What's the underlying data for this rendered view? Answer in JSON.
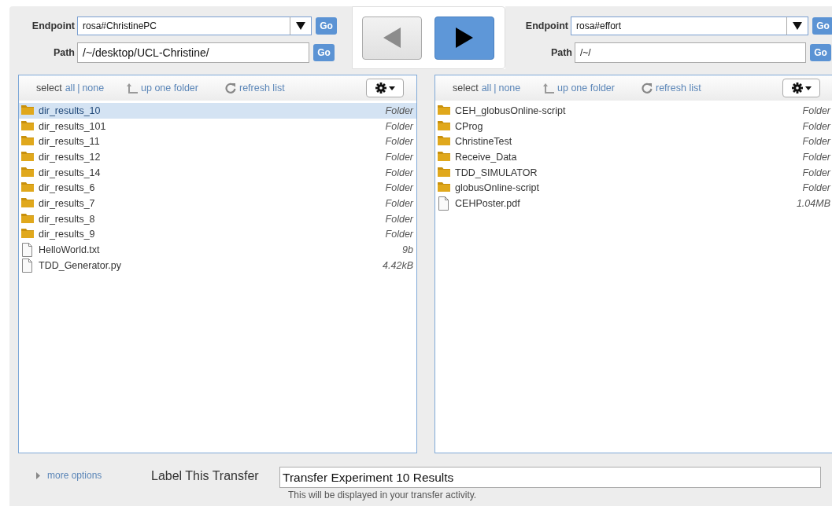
{
  "endpoints": [
    {
      "endpoint_label": "Endpoint",
      "endpoint": "rosa#ChristinePC",
      "endpoint_go": "Go",
      "path_label": "Path",
      "path": "/~/desktop/UCL-Christine/",
      "path_go": "Go"
    },
    {
      "endpoint_label": "Endpoint",
      "endpoint": "rosa#effort",
      "endpoint_go": "Go",
      "path_label": "Path",
      "path": "/~/",
      "path_go": "Go"
    }
  ],
  "transfer_buttons": [
    {
      "kind": "left",
      "active": false
    },
    {
      "kind": "right",
      "active": true
    }
  ],
  "file_lists": [
    {
      "toolbar": {
        "select": "select",
        "all": "all",
        "separator": "|",
        "none": "none",
        "up": "up one folder",
        "refresh": "refresh list"
      },
      "items": [
        {
          "kind": "folder",
          "name": "dir_results_10",
          "size": "Folder",
          "selected": true
        },
        {
          "kind": "folder",
          "name": "dir_results_101",
          "size": "Folder",
          "selected": false
        },
        {
          "kind": "folder",
          "name": "dir_results_11",
          "size": "Folder",
          "selected": false
        },
        {
          "kind": "folder",
          "name": "dir_results_12",
          "size": "Folder",
          "selected": false
        },
        {
          "kind": "folder",
          "name": "dir_results_14",
          "size": "Folder",
          "selected": false
        },
        {
          "kind": "folder",
          "name": "dir_results_6",
          "size": "Folder",
          "selected": false
        },
        {
          "kind": "folder",
          "name": "dir_results_7",
          "size": "Folder",
          "selected": false
        },
        {
          "kind": "folder",
          "name": "dir_results_8",
          "size": "Folder",
          "selected": false
        },
        {
          "kind": "folder",
          "name": "dir_results_9",
          "size": "Folder",
          "selected": false
        },
        {
          "kind": "file",
          "name": "HelloWorld.txt",
          "size": "9b",
          "selected": false
        },
        {
          "kind": "file",
          "name": "TDD_Generator.py",
          "size": "4.42kB",
          "selected": false
        }
      ]
    },
    {
      "toolbar": {
        "select": "select",
        "all": "all",
        "separator": "|",
        "none": "none",
        "up": "up one folder",
        "refresh": "refresh list"
      },
      "items": [
        {
          "kind": "folder",
          "name": "CEH_globusOnline-script",
          "size": "Folder",
          "selected": false
        },
        {
          "kind": "folder",
          "name": "CProg",
          "size": "Folder",
          "selected": false
        },
        {
          "kind": "folder",
          "name": "ChristineTest",
          "size": "Folder",
          "selected": false
        },
        {
          "kind": "folder",
          "name": "Receive_Data",
          "size": "Folder",
          "selected": false
        },
        {
          "kind": "folder",
          "name": "TDD_SIMULATOR",
          "size": "Folder",
          "selected": false
        },
        {
          "kind": "folder",
          "name": "globusOnline-script",
          "size": "Folder",
          "selected": false
        },
        {
          "kind": "file",
          "name": "CEHPoster.pdf",
          "size": "1.04MB",
          "selected": false
        }
      ]
    }
  ],
  "footer": {
    "more_options": "more options",
    "label": "Label This Transfer",
    "value": "Transfer Experiment 10 Results",
    "hint": "This will be displayed in your transfer activity."
  }
}
